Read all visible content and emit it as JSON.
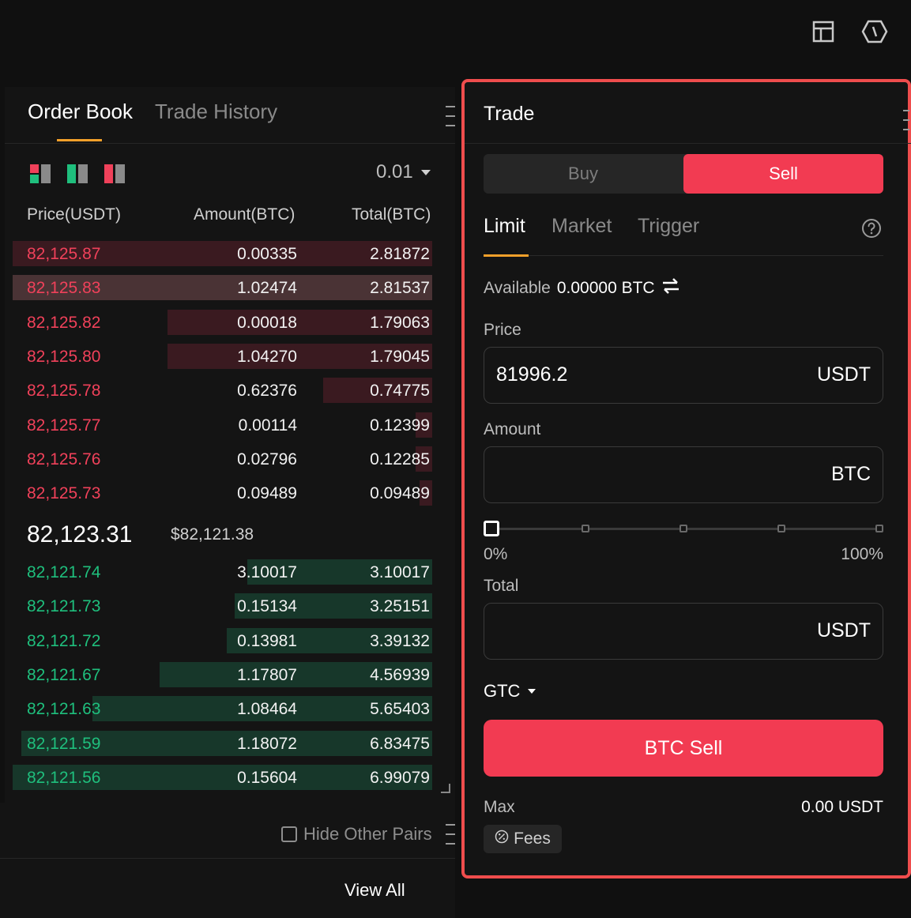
{
  "order_book": {
    "tabs": [
      {
        "label": "Order Book",
        "active": true
      },
      {
        "label": "Trade History",
        "active": false
      }
    ],
    "view_icons": [
      "both-sides-icon",
      "bids-only-icon",
      "asks-only-icon"
    ],
    "precision": "0.01",
    "columns": {
      "price": "Price(USDT)",
      "amount": "Amount(BTC)",
      "total": "Total(BTC)"
    },
    "asks": [
      {
        "price": "82,125.87",
        "amount": "0.00335",
        "total": "2.81872",
        "depth_pct": 100,
        "highlight": false
      },
      {
        "price": "82,125.83",
        "amount": "1.02474",
        "total": "2.81537",
        "depth_pct": 100,
        "highlight": true
      },
      {
        "price": "82,125.82",
        "amount": "0.00018",
        "total": "1.79063",
        "depth_pct": 63
      },
      {
        "price": "82,125.80",
        "amount": "1.04270",
        "total": "1.79045",
        "depth_pct": 63
      },
      {
        "price": "82,125.78",
        "amount": "0.62376",
        "total": "0.74775",
        "depth_pct": 26
      },
      {
        "price": "82,125.77",
        "amount": "0.00114",
        "total": "0.12399",
        "depth_pct": 4
      },
      {
        "price": "82,125.76",
        "amount": "0.02796",
        "total": "0.12285",
        "depth_pct": 4
      },
      {
        "price": "82,125.73",
        "amount": "0.09489",
        "total": "0.09489",
        "depth_pct": 3
      }
    ],
    "last_price": "82,123.31",
    "last_price_usd": "$82,121.38",
    "bids": [
      {
        "price": "82,121.74",
        "amount": "3.10017",
        "total": "3.10017",
        "depth_pct": 44
      },
      {
        "price": "82,121.73",
        "amount": "0.15134",
        "total": "3.25151",
        "depth_pct": 47
      },
      {
        "price": "82,121.72",
        "amount": "0.13981",
        "total": "3.39132",
        "depth_pct": 49
      },
      {
        "price": "82,121.67",
        "amount": "1.17807",
        "total": "4.56939",
        "depth_pct": 65
      },
      {
        "price": "82,121.63",
        "amount": "1.08464",
        "total": "5.65403",
        "depth_pct": 81
      },
      {
        "price": "82,121.59",
        "amount": "1.18072",
        "total": "6.83475",
        "depth_pct": 98
      },
      {
        "price": "82,121.56",
        "amount": "0.15604",
        "total": "6.99079",
        "depth_pct": 100
      }
    ],
    "hide_other_pairs": "Hide Other Pairs",
    "view_all": "View All"
  },
  "trade": {
    "title": "Trade",
    "side": {
      "buy": "Buy",
      "sell": "Sell",
      "selected": "Sell"
    },
    "order_types": [
      {
        "label": "Limit",
        "active": true
      },
      {
        "label": "Market",
        "active": false
      },
      {
        "label": "Trigger",
        "active": false
      }
    ],
    "available_label": "Available",
    "available_value": "0.00000 BTC",
    "price_label": "Price",
    "price_value": "81996.2",
    "price_unit": "USDT",
    "amount_label": "Amount",
    "amount_value": "",
    "amount_unit": "BTC",
    "slider": {
      "value_pct": 0,
      "min_label": "0%",
      "max_label": "100%"
    },
    "total_label": "Total",
    "total_value": "",
    "total_unit": "USDT",
    "time_in_force": "GTC",
    "submit_label": "BTC Sell",
    "max_label": "Max",
    "max_value": "0.00 USDT",
    "fees_label": "Fees"
  },
  "colors": {
    "ask": "#f0415a",
    "bid": "#1fbf7d",
    "sell_button": "#f23b52",
    "accent": "#f3a02a",
    "highlight_border": "#ef4d4d"
  }
}
